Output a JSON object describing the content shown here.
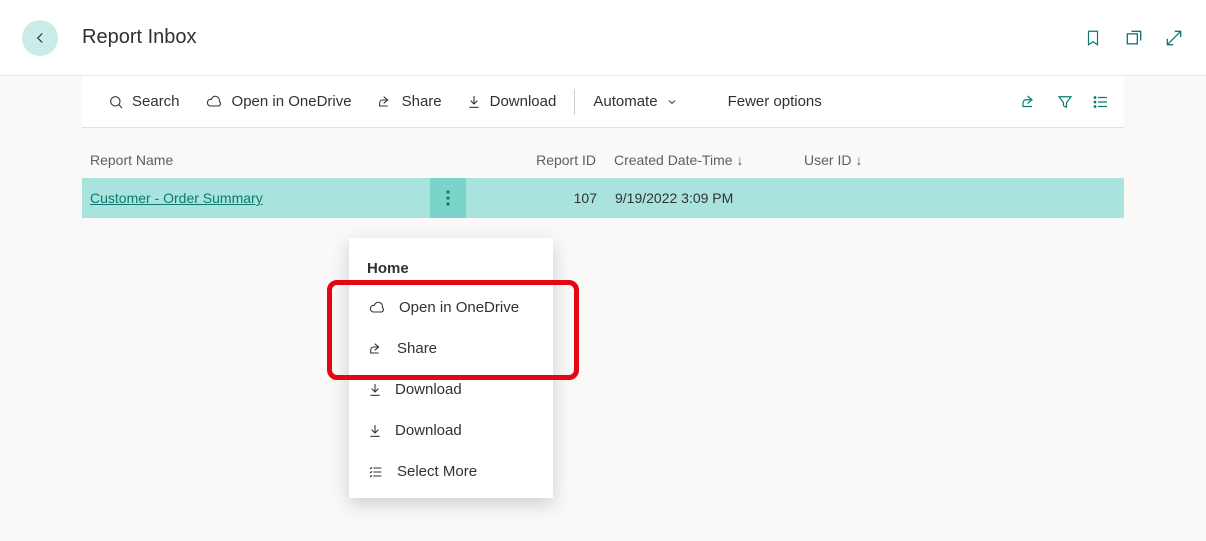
{
  "header": {
    "title": "Report Inbox"
  },
  "toolbar": {
    "search": "Search",
    "open_onedrive": "Open in OneDrive",
    "share": "Share",
    "download": "Download",
    "automate": "Automate",
    "fewer_options": "Fewer options"
  },
  "grid": {
    "columns": {
      "report_name": "Report Name",
      "report_id": "Report ID",
      "created": "Created Date-Time",
      "user_id": "User ID"
    },
    "rows": [
      {
        "name": "Customer - Order Summary",
        "report_id": "107",
        "created": "9/19/2022 3:09 PM",
        "user_id": ""
      }
    ]
  },
  "context_menu": {
    "header": "Home",
    "items": [
      {
        "label": "Open in OneDrive",
        "icon": "cloud-icon"
      },
      {
        "label": "Share",
        "icon": "share-icon"
      },
      {
        "label": "Download",
        "icon": "download-icon"
      },
      {
        "label": "Download",
        "icon": "download-icon"
      },
      {
        "label": "Select More",
        "icon": "list-icon"
      }
    ]
  }
}
